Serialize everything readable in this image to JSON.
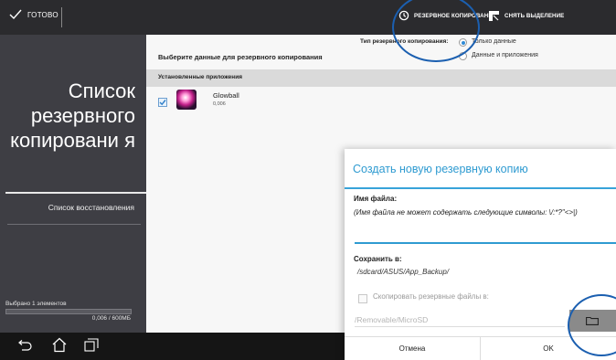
{
  "topbar": {
    "done_label": "ГОТОВО",
    "backup_label": "РЕЗЕРВНОЕ КОПИРОВАНИЕ",
    "clear_selection_label": "СНЯТЬ ВЫДЕЛЕНИЕ"
  },
  "left_panel": {
    "title": "Список резервного копировани я",
    "restore_list_label": "Список восстановления",
    "selected_text": "Выбрано 1 элементов",
    "size_text": "0,006 / 600МБ",
    "progress_fraction": 0.0
  },
  "main": {
    "select_data_label": "Выберите данные для резервного копирования",
    "backup_type_label": "Тип резервного копирования:",
    "backup_type_options": [
      "Только данные",
      "Данные и приложения"
    ],
    "backup_type_selected": "Только данные",
    "section_header": "Установленные приложения",
    "apps": [
      {
        "name": "Glowball",
        "size": "0,006",
        "checked": true
      }
    ]
  },
  "dialog": {
    "title": "Создать новую резервную копию",
    "file_name_label": "Имя файла:",
    "file_name_note": "(Имя файла не может содержать следующие символы: \\/:*?\"<>|)",
    "file_name_value": "",
    "save_to_label": "Сохранить в:",
    "save_to_path": "/sdcard/ASUS/App_Backup/",
    "copy_backup_label": "Скопировать резервные файлы в:",
    "copy_backup_checked": false,
    "copy_destination": "/Removable/MicroSD",
    "cancel_label": "Отмена",
    "ok_label": "OK"
  },
  "colors": {
    "accent": "#2f9bd1",
    "topbar_bg": "#2b2b2e",
    "left_panel_bg": "#3e3e44",
    "callout": "#1b5fb0"
  },
  "icons": [
    "checkmark-icon",
    "backup-icon",
    "deselect-icon",
    "back-icon",
    "home-icon",
    "recent-apps-icon",
    "folder-icon"
  ]
}
